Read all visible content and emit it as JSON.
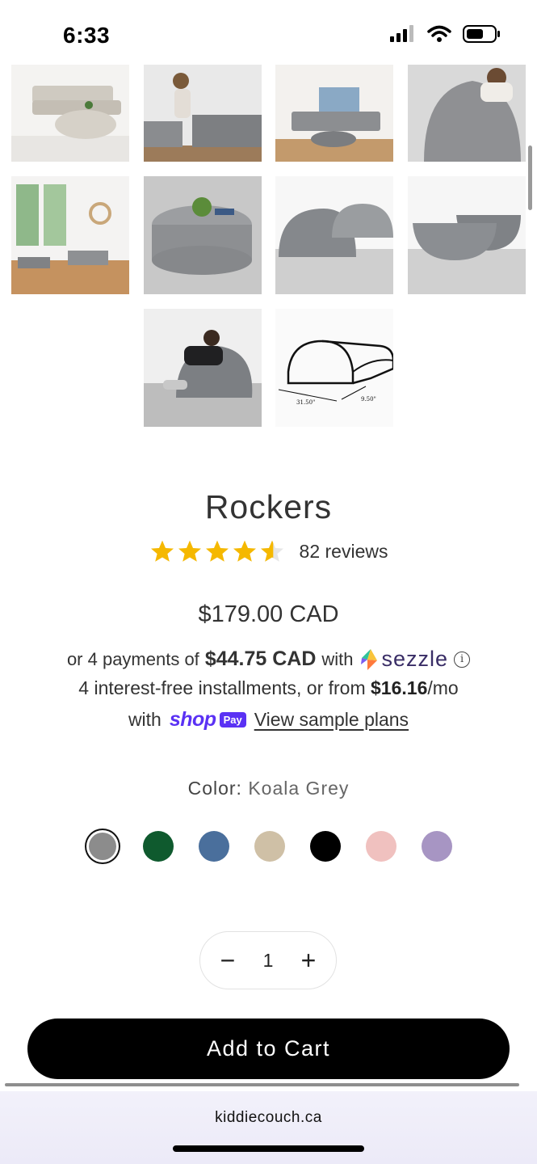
{
  "status": {
    "time": "6:33"
  },
  "gallery": {
    "images": [
      "sofa-and-ottoman",
      "boy-playing-on-couch",
      "living-room-setup",
      "child-on-rocker",
      "room-with-pieces",
      "round-table-with-plant",
      "rockers-pair",
      "rockers-side",
      "boy-hugging-rocker",
      "rocker-dimension-diagram"
    ],
    "diagram_dims": [
      "31.50\"",
      "9.50\""
    ]
  },
  "product": {
    "title": "Rockers",
    "rating": 4.5,
    "reviews_label": "82 reviews",
    "price": "$179.00 CAD"
  },
  "sezzle": {
    "prefix": "or 4 payments of",
    "amount": "$44.75 CAD",
    "with": "with",
    "brand": "sezzle",
    "info": "i"
  },
  "shoppay": {
    "line1_text": "4 interest-free installments, or from ",
    "line1_amount": "$16.16",
    "line1_suffix": "/mo",
    "with": "with",
    "brand": "shop",
    "badge": "Pay",
    "link": "View sample plans"
  },
  "color": {
    "label": "Color:",
    "value": "Koala Grey",
    "swatches": [
      {
        "name": "Koala Grey",
        "hex": "#8c8c8c",
        "selected": true
      },
      {
        "name": "green",
        "hex": "#0f5a2e"
      },
      {
        "name": "blue",
        "hex": "#4a6f9c"
      },
      {
        "name": "beige",
        "hex": "#cfc0a6"
      },
      {
        "name": "black",
        "hex": "#000000"
      },
      {
        "name": "pink",
        "hex": "#f0c1bf"
      },
      {
        "name": "lavender",
        "hex": "#a795c3"
      }
    ]
  },
  "quantity": {
    "minus": "−",
    "value": "1",
    "plus": "+"
  },
  "cart": {
    "label": "Add to Cart"
  },
  "browser": {
    "url": "kiddiecouch.ca"
  }
}
